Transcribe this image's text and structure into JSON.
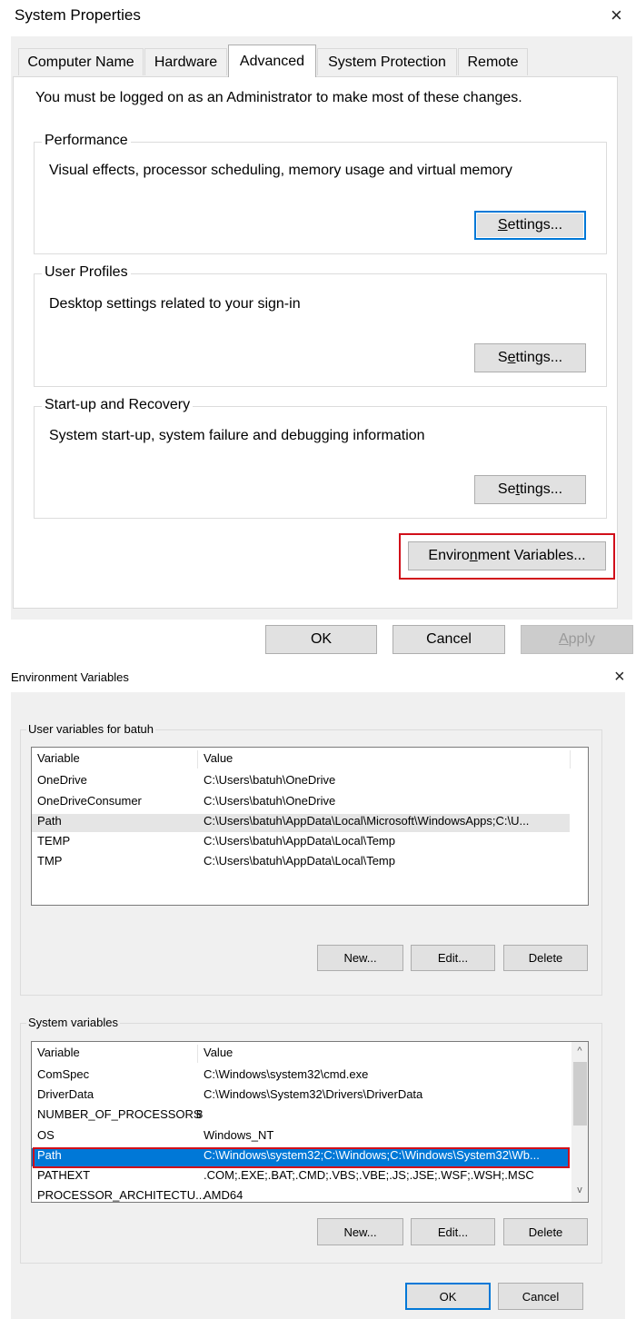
{
  "system_properties": {
    "title": "System Properties",
    "close_glyph": "×",
    "tabs": [
      {
        "label": "Computer Name"
      },
      {
        "label": "Hardware"
      },
      {
        "label": "Advanced"
      },
      {
        "label": "System Protection"
      },
      {
        "label": "Remote"
      }
    ],
    "admin_notice": "You must be logged on as an Administrator to make most of these changes.",
    "performance": {
      "label": "Performance",
      "description": "Visual effects, processor scheduling, memory usage and virtual memory",
      "settings_pre": "",
      "settings_key": "S",
      "settings_post": "ettings..."
    },
    "user_profiles": {
      "label": "User Profiles",
      "description": "Desktop settings related to your sign-in",
      "settings_pre": "S",
      "settings_key": "e",
      "settings_post": "ttings..."
    },
    "startup_recovery": {
      "label": "Start-up and Recovery",
      "description": "System start-up, system failure and debugging information",
      "settings_pre": "Se",
      "settings_key": "t",
      "settings_post": "tings..."
    },
    "env_button": {
      "pre": "Enviro",
      "key": "n",
      "post": "ment Variables..."
    },
    "ok_label": "OK",
    "cancel_label": "Cancel",
    "apply_pre": "",
    "apply_key": "A",
    "apply_post": "pply"
  },
  "environment_variables": {
    "title": "Environment Variables",
    "close_glyph": "×",
    "user_group_label": "User variables for batuh",
    "system_group_label": "System variables",
    "columns": {
      "variable": "Variable",
      "value": "Value"
    },
    "user_vars": [
      {
        "name": "OneDrive",
        "value": "C:\\Users\\batuh\\OneDrive"
      },
      {
        "name": "OneDriveConsumer",
        "value": "C:\\Users\\batuh\\OneDrive"
      },
      {
        "name": "Path",
        "value": "C:\\Users\\batuh\\AppData\\Local\\Microsoft\\WindowsApps;C:\\U..."
      },
      {
        "name": "TEMP",
        "value": "C:\\Users\\batuh\\AppData\\Local\\Temp"
      },
      {
        "name": "TMP",
        "value": "C:\\Users\\batuh\\AppData\\Local\\Temp"
      }
    ],
    "system_vars": [
      {
        "name": "ComSpec",
        "value": "C:\\Windows\\system32\\cmd.exe"
      },
      {
        "name": "DriverData",
        "value": "C:\\Windows\\System32\\Drivers\\DriverData"
      },
      {
        "name": "NUMBER_OF_PROCESSORS",
        "value": "8"
      },
      {
        "name": "OS",
        "value": "Windows_NT"
      },
      {
        "name": "Path",
        "value": "C:\\Windows\\system32;C:\\Windows;C:\\Windows\\System32\\Wb..."
      },
      {
        "name": "PATHEXT",
        "value": ".COM;.EXE;.BAT;.CMD;.VBS;.VBE;.JS;.JSE;.WSF;.WSH;.MSC"
      },
      {
        "name": "PROCESSOR_ARCHITECTU...",
        "value": "AMD64"
      }
    ],
    "buttons": {
      "new": "New...",
      "edit": "Edit...",
      "delete": "Delete",
      "ok": "OK",
      "cancel": "Cancel"
    },
    "scroll_up_glyph": "^",
    "scroll_down_glyph": "v"
  }
}
